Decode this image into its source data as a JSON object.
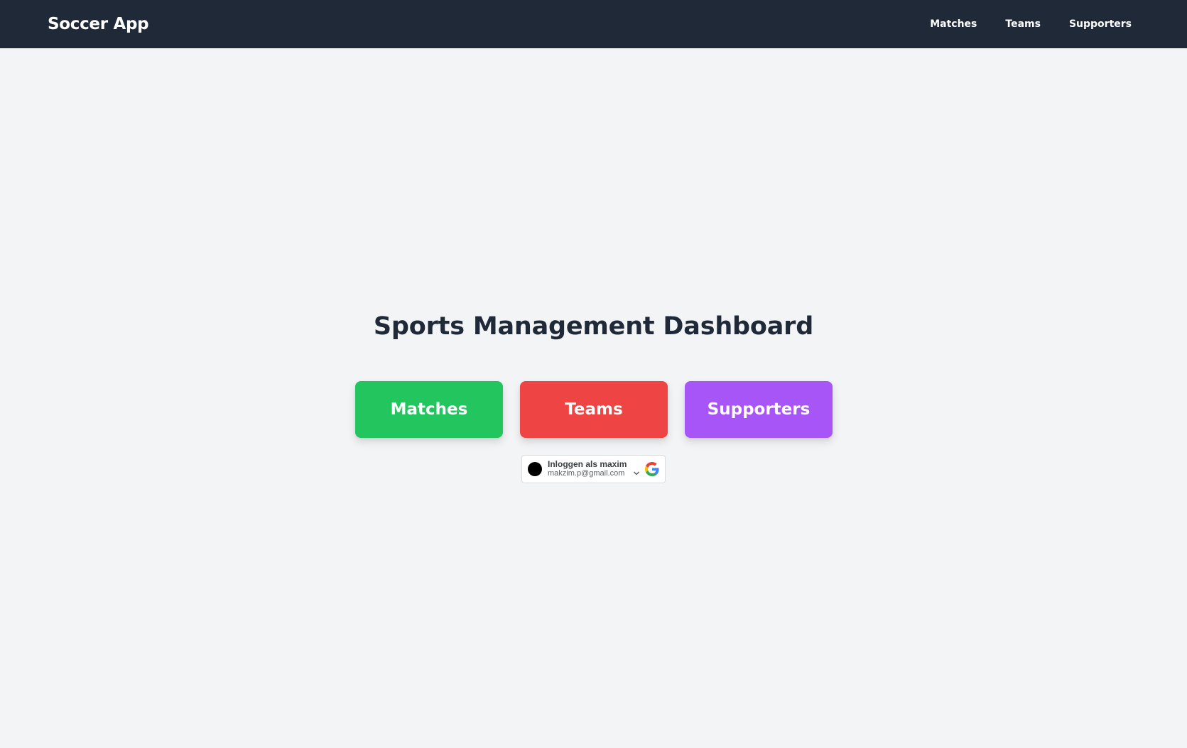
{
  "app": {
    "brand": "Soccer App"
  },
  "nav": {
    "items": [
      {
        "label": "Matches"
      },
      {
        "label": "Teams"
      },
      {
        "label": "Supporters"
      }
    ]
  },
  "main": {
    "title": "Sports Management Dashboard",
    "tiles": [
      {
        "label": "Matches",
        "color": "#22c55e"
      },
      {
        "label": "Teams",
        "color": "#ef4444"
      },
      {
        "label": "Supporters",
        "color": "#a855f7"
      }
    ]
  },
  "google_signin": {
    "line1": "Inloggen als maxim",
    "line2": "makzim.p@gmail.com",
    "icons": [
      "avatar",
      "chevron-down-icon",
      "google-logo-icon"
    ]
  }
}
